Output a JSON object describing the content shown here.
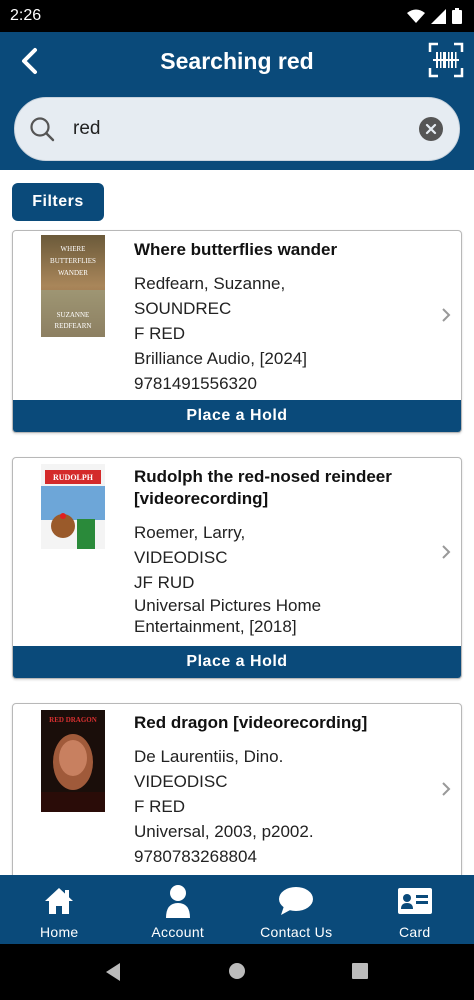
{
  "status": {
    "time": "2:26"
  },
  "header": {
    "title": "Searching red"
  },
  "search": {
    "value": "red"
  },
  "filters_label": "Filters",
  "results": [
    {
      "title": "Where butterflies wander",
      "author": "Redfearn, Suzanne,",
      "format": "SOUNDREC",
      "call_number": "F RED",
      "publisher": "Brilliance Audio, [2024]",
      "isbn": "9781491556320",
      "hold_label": "Place a Hold",
      "cover": {
        "line1": "WHERE",
        "line2": "BUTTERFLIES",
        "line3": "WANDER",
        "line4": "SUZANNE",
        "line5": "REDFEARN"
      }
    },
    {
      "title_line1": "Rudolph the red-nosed reindeer",
      "title_line2": "[videorecording]",
      "author": "Roemer, Larry,",
      "format": "VIDEODISC",
      "call_number": "JF RUD",
      "publisher_line1": "Universal Pictures Home",
      "publisher_line2": "Entertainment, [2018]",
      "hold_label": "Place a Hold",
      "cover": {
        "line1": "RUDOLPH"
      }
    },
    {
      "title": "Red dragon [videorecording]",
      "author": "De Laurentiis, Dino.",
      "format": "VIDEODISC",
      "call_number": "F RED",
      "publisher": "Universal, 2003, p2002.",
      "isbn": "9780783268804",
      "cover": {
        "line1": "RED DRAGON"
      }
    }
  ],
  "bottom_nav": [
    {
      "label": "Home",
      "icon": "home-icon"
    },
    {
      "label": "Account",
      "icon": "account-icon"
    },
    {
      "label": "Contact Us",
      "icon": "chat-icon"
    },
    {
      "label": "Card",
      "icon": "card-icon"
    }
  ],
  "colors": {
    "primary": "#0a4a7a",
    "search_bg": "#e6ecf2"
  }
}
